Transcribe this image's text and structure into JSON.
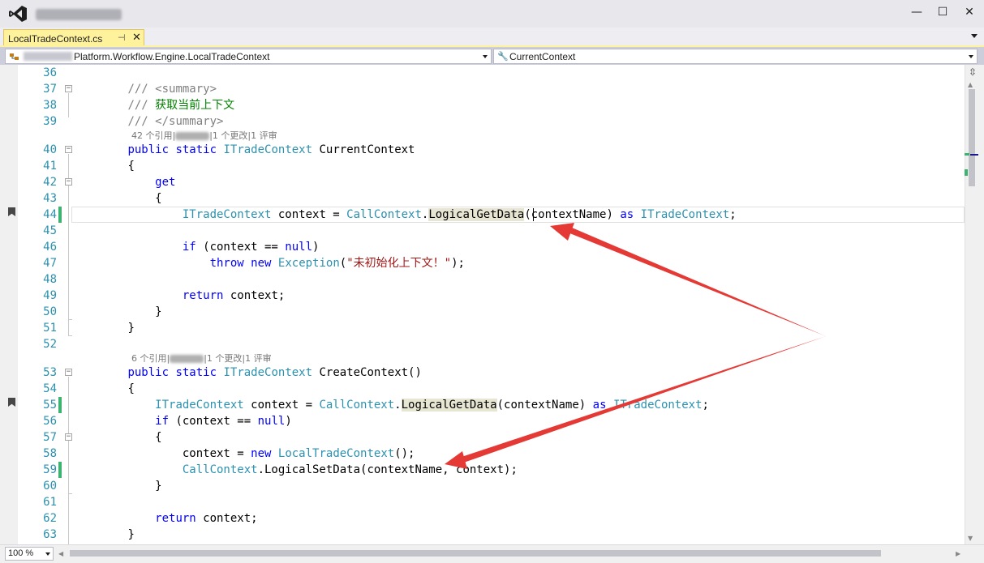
{
  "window": {
    "minimize_glyph": "—",
    "maximize_glyph": "☐",
    "close_glyph": "✕"
  },
  "tab": {
    "label": "LocalTradeContext.cs",
    "pin_glyph": "⊣",
    "close_glyph": "✕"
  },
  "nav": {
    "left_value": "Platform.Workflow.Engine.LocalTradeContext",
    "right_value": "CurrentContext"
  },
  "editor": {
    "line_numbers": [
      "36",
      "37",
      "38",
      "39",
      "40",
      "41",
      "42",
      "43",
      "44",
      "45",
      "46",
      "47",
      "48",
      "49",
      "50",
      "51",
      "52",
      "53",
      "54",
      "55",
      "56",
      "57",
      "58",
      "59",
      "60",
      "61",
      "62",
      "63"
    ],
    "codelens": [
      {
        "refs": "42 个引用",
        "changes": "|1 个更改|1 评审"
      },
      {
        "refs": "6 个引用",
        "changes": "|1 个更改|1 评审"
      }
    ],
    "code": {
      "l37_a": "/// ",
      "l37_b": "<summary>",
      "l38_a": "/// ",
      "l38_b": "获取当前上下文",
      "l39_a": "/// ",
      "l39_b": "</summary>",
      "l40_public": "public",
      "l40_static": "static",
      "l40_type": "ITradeContext",
      "l40_name": "CurrentContext",
      "brace_open": "{",
      "brace_close": "}",
      "l42": "get",
      "l44_type": "ITradeContext",
      "l44_var": " context = ",
      "l44_cls": "CallContext",
      "l44_dot": ".",
      "l44_method": "LogicalGetData",
      "l44_args": "(contextName) ",
      "l44_as": "as",
      "l44_type2": "ITradeContext",
      "l44_end": ";",
      "l46_if": "if",
      "l46_rest": " (context == ",
      "l46_null": "null",
      "l46_close": ")",
      "l47_throw": "throw",
      "l47_new": "new",
      "l47_ex": "Exception",
      "l47_open": "(",
      "l47_str": "\"未初始化上下文！\"",
      "l47_end": ");",
      "l49_return": "return",
      "l49_rest": " context;",
      "l53_public": "public",
      "l53_static": "static",
      "l53_type": "ITradeContext",
      "l53_name": "CreateContext()",
      "l55_type": "ITradeContext",
      "l55_var": " context = ",
      "l55_cls": "CallContext",
      "l55_dot": ".",
      "l55_method": "LogicalGetData",
      "l55_args": "(contextName) ",
      "l55_as": "as",
      "l55_type2": "ITradeContext",
      "l55_end": ";",
      "l56_if": "if",
      "l56_rest": " (context == ",
      "l56_null": "null",
      "l56_close": ")",
      "l58_a": "context = ",
      "l58_new": "new",
      "l58_type": "LocalTradeContext",
      "l58_end": "();",
      "l59_cls": "CallContext",
      "l59_rest": ".LogicalSetData(contextName, context);",
      "l62_return": "return",
      "l62_rest": " context;"
    }
  },
  "zoom": {
    "value": "100 %"
  },
  "colors": {
    "tab_active": "#FFF29D",
    "keyword": "#0000FF",
    "type": "#2B91AF",
    "comment": "#808080",
    "comment_text": "#008000",
    "string": "#A31515",
    "change_marker": "#3CB371",
    "annotation_arrow": "#E53935"
  }
}
